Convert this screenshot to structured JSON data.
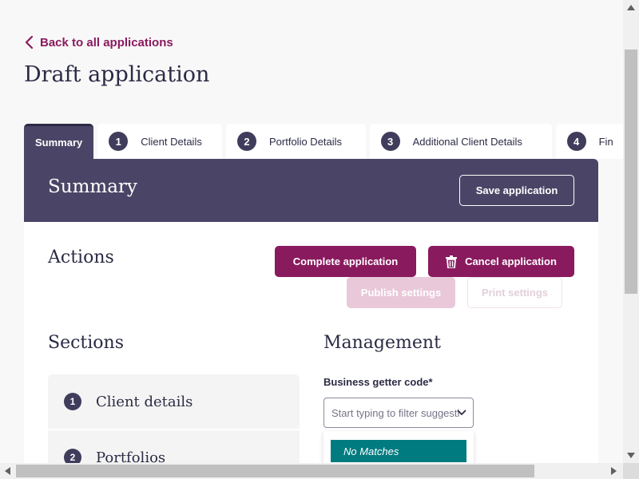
{
  "back_link": {
    "label": "Back to all applications"
  },
  "page_title": "Draft application",
  "tabs": [
    {
      "label": "Summary",
      "number": "",
      "active": true
    },
    {
      "label": "Client Details",
      "number": "1"
    },
    {
      "label": "Portfolio Details",
      "number": "2"
    },
    {
      "label": "Additional Client Details",
      "number": "3"
    },
    {
      "label": "Fin",
      "number": "4"
    }
  ],
  "banner": {
    "title": "Summary",
    "save_label": "Save application"
  },
  "actions": {
    "heading": "Actions",
    "complete_label": "Complete application",
    "cancel_label": "Cancel application",
    "publish_label": "Publish settings",
    "print_label": "Print settings"
  },
  "sections": {
    "heading": "Sections",
    "items": [
      {
        "number": "1",
        "label": "Client details"
      },
      {
        "number": "2",
        "label": "Portfolios"
      }
    ]
  },
  "management": {
    "heading": "Management",
    "field_label": "Business getter code*",
    "placeholder": "Start typing to filter suggestions",
    "no_matches": "No Matches"
  },
  "colors": {
    "accent": "#8a1a5e",
    "banner": "#4a4566",
    "highlight": "#007b80"
  }
}
